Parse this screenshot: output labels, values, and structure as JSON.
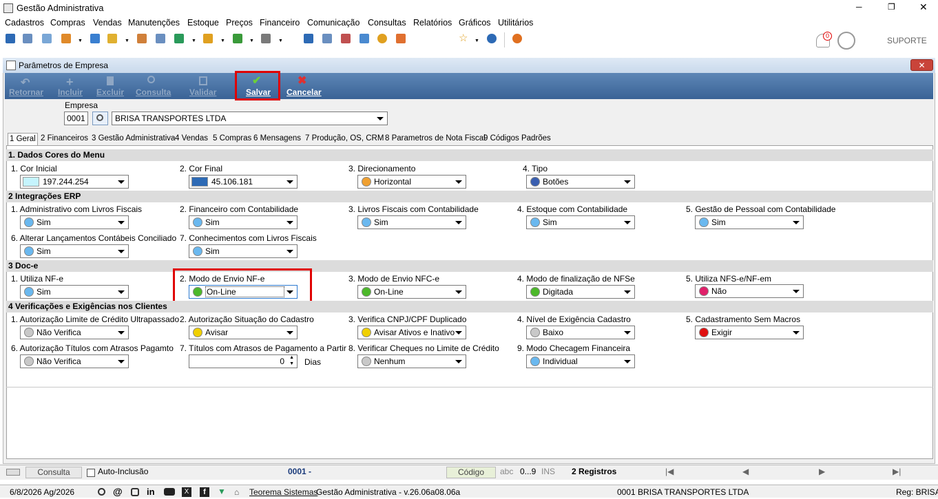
{
  "window": {
    "title": "Gestão Administrativa",
    "minimize": "─",
    "maximize": "❐",
    "close": "✕"
  },
  "menu": [
    "Cadastros",
    "Compras",
    "Vendas",
    "Manutenções",
    "Estoque",
    "Preços",
    "Financeiro",
    "Comunicação",
    "Consultas",
    "Relatórios",
    "Gráficos",
    "Utilitários"
  ],
  "toolbar": {
    "notification_count": "0",
    "user": "SUPORTE"
  },
  "form": {
    "title": "Parâmetros de Empresa",
    "close": "✕",
    "actions": [
      {
        "label": "Retornar",
        "enabled": false
      },
      {
        "label": "Incluir",
        "enabled": false
      },
      {
        "label": "Excluir",
        "enabled": false
      },
      {
        "label": "Consulta",
        "enabled": false
      },
      {
        "label": "Validar",
        "enabled": false
      },
      {
        "label": "Salvar",
        "enabled": true
      },
      {
        "label": "Cancelar",
        "enabled": true
      }
    ],
    "empresa_label": "Empresa",
    "empresa_code": "0001",
    "empresa_name": "BRISA TRANSPORTES LTDA"
  },
  "tabs": [
    "1 Geral",
    "2 Financeiros",
    "3 Gestão Administrativa",
    "4 Vendas",
    "5 Compras",
    "6 Mensagens",
    "7 Produção, OS, CRM",
    "8 Parametros de Nota Fiscal",
    "9 Códigos Padrões"
  ],
  "sections": {
    "s1": {
      "title": "1.  Dados Cores do Menu",
      "f1": {
        "label": "1. Cor Inicial",
        "value": "197.244.254",
        "color": "#c5f4fe"
      },
      "f2": {
        "label": "2. Cor Final",
        "value": "45.106.181",
        "color": "#2d6ab5"
      },
      "f3": {
        "label": "3. Direcionamento",
        "value": "Horizontal",
        "color": "#f0a030"
      },
      "f4": {
        "label": "4. Tipo",
        "value": "Botões",
        "color": "#3a5fb0"
      }
    },
    "s2": {
      "title": "2 Integrações ERP",
      "f1": {
        "label": "1. Administrativo com Livros Fiscais",
        "value": "Sim"
      },
      "f2": {
        "label": "2. Financeiro com Contabilidade",
        "value": "Sim"
      },
      "f3": {
        "label": "3. Livros Fiscais com Contabilidade",
        "value": "Sim"
      },
      "f4": {
        "label": "4. Estoque com Contabilidade",
        "value": "Sim"
      },
      "f5": {
        "label": "5. Gestão de Pessoal com Contabilidade",
        "value": "Sim"
      },
      "f6": {
        "label": "6. Alterar Lançamentos Contábeis Conciliado",
        "value": "Sim"
      },
      "f7": {
        "label": "7. Conhecimentos com Livros Fiscais",
        "value": "Sim"
      }
    },
    "s3": {
      "title": "3  Doc-e",
      "f1": {
        "label": "1. Utiliza NF-e",
        "value": "Sim"
      },
      "f2": {
        "label": "2. Modo de Envio NF-e",
        "value": "On-Line"
      },
      "f3": {
        "label": "3. Modo de Envio NFC-e",
        "value": "On-Line"
      },
      "f4": {
        "label": "4. Modo de finalização de NFSe",
        "value": "Digitada"
      },
      "f5": {
        "label": "5. Utiliza NFS-e/NF-em",
        "value": "Não"
      }
    },
    "s4": {
      "title": "4 Verificações e Exigências nos Clientes",
      "f1": {
        "label": "1. Autorização Limite de Crédito Ultrapassado",
        "value": "Não Verifica"
      },
      "f2": {
        "label": "2. Autorização Situação do Cadastro",
        "value": "Avisar"
      },
      "f3": {
        "label": "3. Verifica CNPJ/CPF Duplicado",
        "value": "Avisar Ativos e Inativo"
      },
      "f4": {
        "label": "4. Nível de Exigência Cadastro",
        "value": "Baixo"
      },
      "f5": {
        "label": "5. Cadastramento Sem Macros",
        "value": "Exigir"
      },
      "f6": {
        "label": "6. Autorização Títulos com Atrasos Pagamto",
        "value": "Não Verifica"
      },
      "f7": {
        "label": "7. Títulos com Atrasos de Pagamento a Partir",
        "value": "0",
        "unit": "Dias"
      },
      "f8": {
        "label": "8. Verificar Cheques no Limite de Crédito",
        "value": "Nenhum"
      },
      "f9": {
        "label": "9. Modo Checagem Financeira",
        "value": "Individual"
      }
    }
  },
  "status": {
    "consulta": "Consulta",
    "auto": "Auto-Inclusão",
    "code": "0001 -",
    "codigo": "Código",
    "abc": "abc",
    "range": "0...9",
    "ins": "INS",
    "registros": "2 Registros",
    "first": "|◀",
    "prev": "◀",
    "next": "▶",
    "last": "▶|"
  },
  "footer": {
    "date": "6/8/2026 Ag/2026",
    "company_link": "Teorema Sistemas",
    "version": "Gestão Administrativa - v.26.06a08.06a",
    "empresa": "0001 BRISA TRANSPORTES LTDA",
    "reg": "Reg: BRISA"
  }
}
